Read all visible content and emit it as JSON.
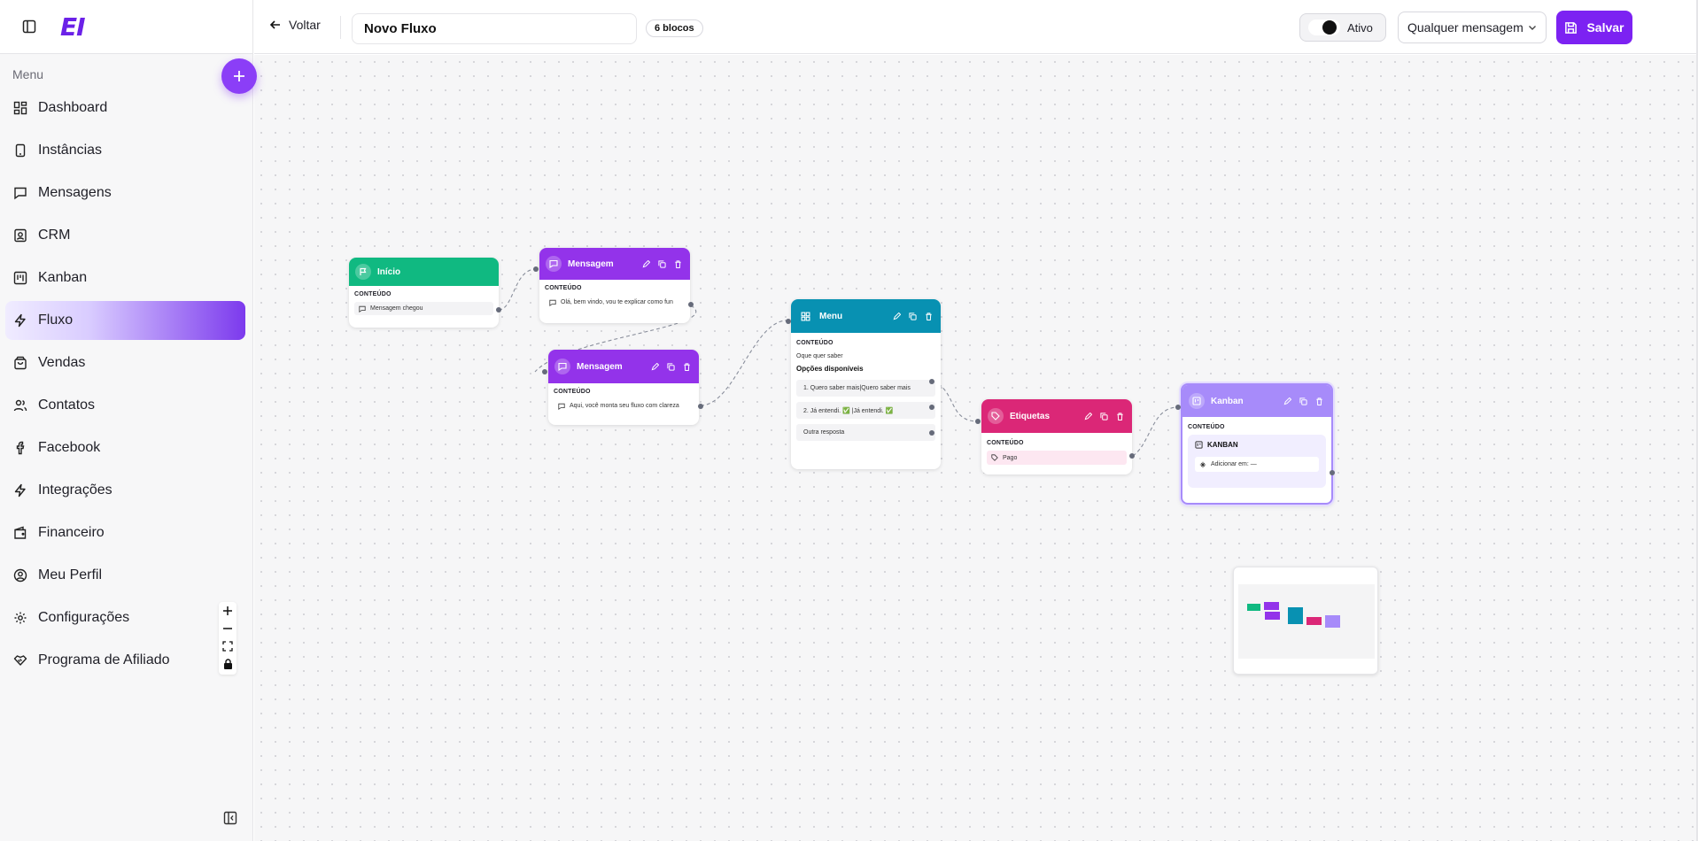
{
  "sidebar": {
    "menu_label": "Menu",
    "logo_text": "EI",
    "items": [
      {
        "label": "Dashboard",
        "icon": "grid-icon"
      },
      {
        "label": "Instâncias",
        "icon": "phone-icon"
      },
      {
        "label": "Mensagens",
        "icon": "message-icon"
      },
      {
        "label": "CRM",
        "icon": "contact-card-icon"
      },
      {
        "label": "Kanban",
        "icon": "kanban-icon"
      },
      {
        "label": "Fluxo",
        "icon": "zap-icon",
        "active": true
      },
      {
        "label": "Vendas",
        "icon": "bag-icon"
      },
      {
        "label": "Contatos",
        "icon": "users-icon"
      },
      {
        "label": "Facebook",
        "icon": "facebook-icon"
      },
      {
        "label": "Integrações",
        "icon": "zap-icon"
      },
      {
        "label": "Financeiro",
        "icon": "wallet-icon"
      },
      {
        "label": "Meu Perfil",
        "icon": "user-circle-icon"
      },
      {
        "label": "Configurações",
        "icon": "gear-icon"
      },
      {
        "label": "Programa de Afiliado",
        "icon": "handshake-icon"
      }
    ]
  },
  "topbar": {
    "back_label": "Voltar",
    "flow_name": "Novo Fluxo",
    "block_count": "6 blocos",
    "active_label": "Ativo",
    "trigger_value": "Qualquer mensagem nova",
    "save_label": "Salvar"
  },
  "nodes": {
    "inicio": {
      "title": "Início",
      "section": "CONTEÚDO",
      "content": "Mensagem chegou",
      "color": "#10b981"
    },
    "msg1": {
      "title": "Mensagem",
      "section": "CONTEÚDO",
      "content": "Olá, bem vindo, vou te explicar como fun",
      "color": "#9333ea"
    },
    "msg2": {
      "title": "Mensagem",
      "section": "CONTEÚDO",
      "content": "Aqui, você monta seu fluxo com clareza",
      "color": "#9333ea"
    },
    "menu": {
      "title": "Menu",
      "section": "CONTEÚDO",
      "question": "Oque quer saber",
      "options_label": "Opções disponíveis",
      "options": [
        "1.  Quero saber mais|Quero saber mais",
        "2.  Já entendi. ✅ |Já entendi. ✅"
      ],
      "other": "Outra resposta",
      "color": "#0891b2"
    },
    "etiquetas": {
      "title": "Etiquetas",
      "section": "CONTEÚDO",
      "tag": "Pago",
      "color": "#db2777"
    },
    "kanban": {
      "title": "Kanban",
      "section": "CONTEÚDO",
      "box_title": "KANBAN",
      "add_label": "Adicionar em: —",
      "color": "#a78bfa"
    }
  }
}
